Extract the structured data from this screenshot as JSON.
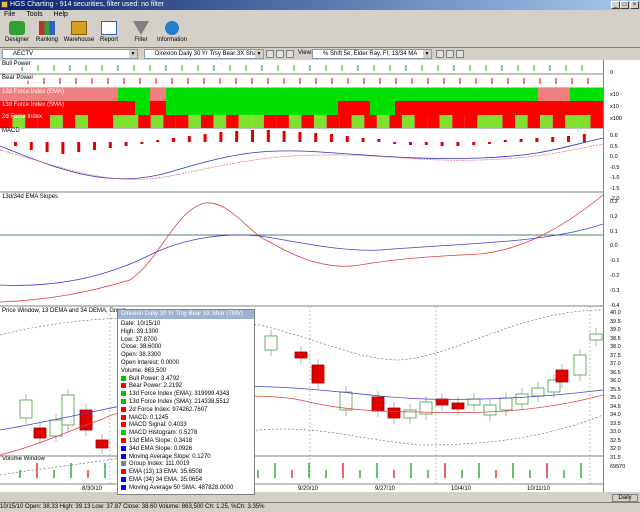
{
  "window": {
    "title": "HGS Charting - 914 securities, filter used: no filter",
    "min": "_",
    "max": "□",
    "close": "×"
  },
  "menu": [
    "File",
    "Tools",
    "Help"
  ],
  "toolbar": {
    "buttons": [
      {
        "label": "Designer",
        "color": "#30a030"
      },
      {
        "label": "Ranking",
        "color": "#c03030"
      },
      {
        "label": "Warehouse",
        "color": "#d8a020"
      },
      {
        "label": "Report",
        "color": "#3060c0"
      },
      {
        "label": "Filter",
        "color": "#808080"
      },
      {
        "label": "Information",
        "color": "#2080d0"
      }
    ]
  },
  "options": {
    "symbol": "AECTV",
    "security": "Direxion Daily 30 Yr Trsy Bear 3X Shar",
    "view_label": "View:",
    "view": "% Shift 5e, Elder Ray, FI, 13/34 MA"
  },
  "panels": {
    "bull_power": "Bull Power",
    "bear_power": "Bear Power",
    "fi13ema": "13d Force Index (EMA)",
    "fi13sma": "13d Force Index (SMA)",
    "fi2d": "2d Force Index",
    "macd": "MACD",
    "slopes": "13d/34d EMA Slopes",
    "price": "Price Window, 13 DEMA and 34 DEMA, Group",
    "volume": "Volume Window"
  },
  "band_axis": {
    "r1": "x10",
    "r2": "x10",
    "r3": "x100"
  },
  "colors": {
    "green": "#00e000",
    "red": "#ff0000",
    "pink": "#f08080",
    "lime": "#80e030"
  },
  "macd_axis": [
    "0.6",
    "0.5",
    "0.0",
    "-0.5",
    "-1.0",
    "-1.5",
    "-2.0"
  ],
  "slope_axis": [
    "0.3",
    "0.2",
    "0.1",
    "0.0",
    "-0.1",
    "-0.2",
    "-0.3",
    "-0.4"
  ],
  "price_axis": [
    "40.0",
    "39.5",
    "39.0",
    "38.5",
    "38.0",
    "37.5",
    "37.0",
    "36.5",
    "36.0",
    "35.5",
    "35.0",
    "34.5",
    "34.0",
    "33.5",
    "33.0",
    "32.5",
    "32.0",
    "31.5"
  ],
  "volume_axis": "69570",
  "x_dates": [
    "8/30/10",
    "9/20/10",
    "9/27/10",
    "10/4/10",
    "10/11/10"
  ],
  "daily": "Daily",
  "infobox": {
    "header": "Direxion Daily 30 Yr Trsy Bear 3X Shar (TMV)",
    "rows": [
      {
        "text": "Date: 10/15/10",
        "color": ""
      },
      {
        "text": "High: 39.1300",
        "color": ""
      },
      {
        "text": "Low: 37.8700",
        "color": ""
      },
      {
        "text": "Close: 38.6000",
        "color": ""
      },
      {
        "text": "Open: 38.3300",
        "color": ""
      },
      {
        "text": "Open Interest: 0.0000",
        "color": ""
      },
      {
        "text": "Volume: 863,500",
        "color": ""
      },
      {
        "text": "Bull Power: 3.4792",
        "color": "#00c000"
      },
      {
        "text": "Bear Power: 2.2192",
        "color": "#ff0000"
      },
      {
        "text": "13d Force Index (EMA): 319999.4343",
        "color": "#00c000"
      },
      {
        "text": "13d Force Index (SMA): 214338.5512",
        "color": "#00c000"
      },
      {
        "text": "2d Force Index: 974262.7607",
        "color": "#ff0000"
      },
      {
        "text": "MACD: 0.1245",
        "color": "#ff0000"
      },
      {
        "text": "MACD Signal: 0.4033",
        "color": "#ff0000"
      },
      {
        "text": "MACD Histogram: 0.5278",
        "color": "#00c000"
      },
      {
        "text": "13d EMA Slope: 0.3418",
        "color": "#ff0000"
      },
      {
        "text": "34d EMA Slope: 0.0926",
        "color": "#0000ff"
      },
      {
        "text": "Moving Average Slope: 0.1270",
        "color": "#0000ff"
      },
      {
        "text": "Group Index: 111.0019",
        "color": "#808080"
      },
      {
        "text": "EMA (13) 13 EMA: 35.6508",
        "color": "#ff0000"
      },
      {
        "text": "EMA (34) 34 EMA: 35.0654",
        "color": "#0000ff"
      },
      {
        "text": "Moving Average 50 SMA: 487828.0000",
        "color": "#0000ff"
      }
    ]
  },
  "status": "10/15/10 Open: 38.33 High: 39.13 Low: 37.87 Close: 38.60 Volume: 863,500 Ch: 1.25, %Ch: 3.35%",
  "chart_data": {
    "type": "candlestick",
    "title": "Direxion Daily 30 Yr Trsy Bear 3X Shar (TMV)",
    "x": [
      "8/30/10",
      "9/20/10",
      "9/27/10",
      "10/4/10",
      "10/11/10"
    ],
    "ylim": [
      31.5,
      40.0
    ],
    "last_bar": {
      "date": "10/15/10",
      "open": 38.33,
      "high": 39.13,
      "low": 37.87,
      "close": 38.6,
      "volume": 863500
    }
  }
}
